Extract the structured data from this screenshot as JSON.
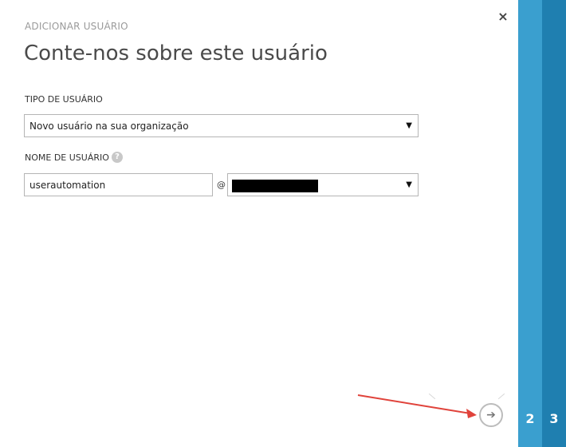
{
  "dialog": {
    "overline": "ADICIONAR USUÁRIO",
    "title": "Conte-nos sobre este usuário",
    "close_label": "×"
  },
  "form": {
    "user_type": {
      "label": "TIPO DE USUÁRIO",
      "selected_value": "Novo usuário na sua organização"
    },
    "user_name": {
      "label": "NOME DE USUÁRIO",
      "help_glyph": "?",
      "value": "userautomation",
      "at_sign": "@"
    },
    "domain": {
      "selected_value": ""
    }
  },
  "footer": {
    "next_icon": "arrow-right-icon",
    "next_glyph": "➔"
  },
  "steps": [
    {
      "number": "2"
    },
    {
      "number": "3"
    }
  ],
  "colors": {
    "step_2": "#3a9fcf",
    "step_3": "#1f7fb0",
    "annotation_arrow": "#e0433b"
  }
}
